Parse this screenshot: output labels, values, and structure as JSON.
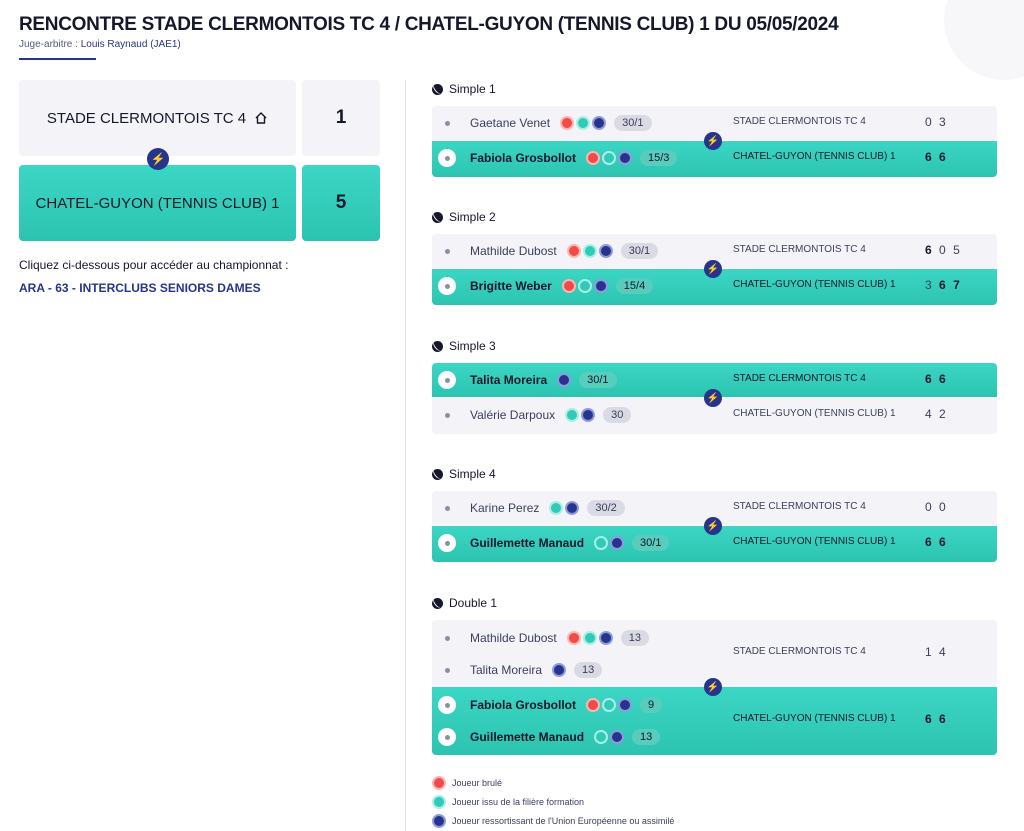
{
  "header": {
    "title": "RENCONTRE STADE CLERMONTOIS TC 4 / CHATEL-GUYON (TENNIS CLUB) 1 DU 05/05/2024",
    "juge_label": "Juge-arbitre :",
    "juge_name": "Louis Raynaud (JAE1)"
  },
  "summary": {
    "home_team": "STADE CLERMONTOIS TC 4",
    "home_score": "1",
    "away_team": "CHATEL-GUYON (TENNIS CLUB) 1",
    "away_score": "5",
    "intro": "Cliquez ci-dessous pour accéder au championnat :",
    "championship_link": "ARA - 63 - INTERCLUBS SENIORS DAMES"
  },
  "colors": {
    "accent_teal": "#3cd6c4",
    "navy": "#27348b",
    "bolt": "#f7d51d",
    "red_badge": "#ef4b4b"
  },
  "matches": [
    {
      "label": "Simple 1",
      "home": {
        "players": [
          {
            "name": "Gaetane Venet",
            "rank": "30/1",
            "badges": [
              "red",
              "teal",
              "blue"
            ]
          }
        ],
        "team": "STADE CLERMONTOIS TC 4",
        "sets": [
          "0",
          "3"
        ],
        "win": false
      },
      "away": {
        "players": [
          {
            "name": "Fabiola Grosbollot",
            "rank": "15/3",
            "badges": [
              "red",
              "teal",
              "blue"
            ]
          }
        ],
        "team": "CHATEL-GUYON (TENNIS CLUB) 1",
        "sets": [
          "6",
          "6"
        ],
        "win": true
      }
    },
    {
      "label": "Simple 2",
      "home": {
        "players": [
          {
            "name": "Mathilde Dubost",
            "rank": "30/1",
            "badges": [
              "red",
              "teal",
              "blue"
            ]
          }
        ],
        "team": "STADE CLERMONTOIS TC 4",
        "sets": [
          "6",
          "0",
          "5"
        ],
        "win": false
      },
      "away": {
        "players": [
          {
            "name": "Brigitte Weber",
            "rank": "15/4",
            "badges": [
              "red",
              "teal",
              "blue"
            ]
          }
        ],
        "team": "CHATEL-GUYON (TENNIS CLUB) 1",
        "sets": [
          "3",
          "6",
          "7"
        ],
        "win": true
      }
    },
    {
      "label": "Simple 3",
      "home": {
        "players": [
          {
            "name": "Talita Moreira",
            "rank": "30/1",
            "badges": [
              "blue"
            ]
          }
        ],
        "team": "STADE CLERMONTOIS TC 4",
        "sets": [
          "6",
          "6"
        ],
        "win": true
      },
      "away": {
        "players": [
          {
            "name": "Valérie Darpoux",
            "rank": "30",
            "badges": [
              "teal",
              "blue"
            ]
          }
        ],
        "team": "CHATEL-GUYON (TENNIS CLUB) 1",
        "sets": [
          "4",
          "2"
        ],
        "win": false
      }
    },
    {
      "label": "Simple 4",
      "home": {
        "players": [
          {
            "name": "Karine Perez",
            "rank": "30/2",
            "badges": [
              "teal",
              "blue"
            ]
          }
        ],
        "team": "STADE CLERMONTOIS TC 4",
        "sets": [
          "0",
          "0"
        ],
        "win": false
      },
      "away": {
        "players": [
          {
            "name": "Guillemette Manaud",
            "rank": "30/1",
            "badges": [
              "teal",
              "blue"
            ]
          }
        ],
        "team": "CHATEL-GUYON (TENNIS CLUB) 1",
        "sets": [
          "6",
          "6"
        ],
        "win": true
      }
    },
    {
      "label": "Double 1",
      "home": {
        "players": [
          {
            "name": "Mathilde Dubost",
            "rank": "13",
            "badges": [
              "red",
              "teal",
              "blue"
            ]
          },
          {
            "name": "Talita Moreira",
            "rank": "13",
            "badges": [
              "blue"
            ]
          }
        ],
        "team": "STADE CLERMONTOIS TC 4",
        "sets": [
          "1",
          "4"
        ],
        "win": false
      },
      "away": {
        "players": [
          {
            "name": "Fabiola Grosbollot",
            "rank": "9",
            "badges": [
              "red",
              "teal",
              "blue"
            ]
          },
          {
            "name": "Guillemette Manaud",
            "rank": "13",
            "badges": [
              "teal",
              "blue"
            ]
          }
        ],
        "team": "CHATEL-GUYON (TENNIS CLUB) 1",
        "sets": [
          "6",
          "6"
        ],
        "win": true
      }
    }
  ],
  "legend": [
    {
      "badge": "red",
      "text": "Joueur brulé"
    },
    {
      "badge": "teal",
      "text": "Joueur issu de la filière formation"
    },
    {
      "badge": "blue",
      "text": "Joueur ressortissant de l'Union Européenne ou assimilé"
    }
  ]
}
